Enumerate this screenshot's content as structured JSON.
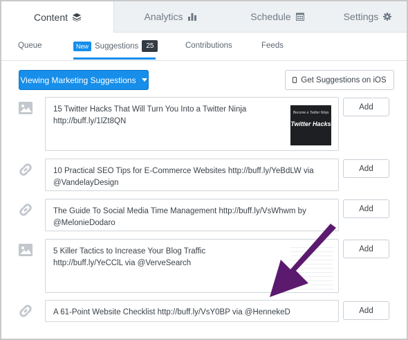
{
  "tabs": [
    {
      "label": "Content",
      "icon": "stack-icon",
      "active": true
    },
    {
      "label": "Analytics",
      "icon": "bar-chart-icon",
      "active": false
    },
    {
      "label": "Schedule",
      "icon": "calendar-icon",
      "active": false
    },
    {
      "label": "Settings",
      "icon": "gear-icon",
      "active": false
    }
  ],
  "subtabs": {
    "queue": "Queue",
    "suggestions": "Suggestions",
    "suggestions_badge_new": "New",
    "suggestions_count": "25",
    "contributions": "Contributions",
    "feeds": "Feeds"
  },
  "actions": {
    "viewing_label": "Viewing Marketing Suggestions",
    "ios_label": "Get Suggestions on iOS"
  },
  "suggestions": [
    {
      "type": "image-icon",
      "line1": "15 Twitter Hacks That Will Turn You Into a Twitter Ninja",
      "line2": "http://buff.ly/1lZt8QN",
      "add": "Add",
      "thumbnail_text": "Twitter Hacks",
      "thumbnail_small": "Become a Twitter Ninja"
    },
    {
      "type": "link-icon",
      "line1": "10 Practical SEO Tips for E-Commerce Websites http://buff.ly/YeBdLW via",
      "line2": "@VandelayDesign",
      "add": "Add"
    },
    {
      "type": "link-icon",
      "line1": "The Guide To Social Media Time Management http://buff.ly/VsWhwm by",
      "line2": "@MelonieDodaro",
      "add": "Add"
    },
    {
      "type": "image-icon",
      "line1": "5 Killer Tactics to Increase Your Blog Traffic",
      "line2": "http://buff.ly/YeCClL via @VerveSearch",
      "add": "Add"
    },
    {
      "type": "link-icon",
      "line1": "A 61-Point Website Checklist http://buff.ly/VsY0BP via @HennekeD",
      "line2": "",
      "add": "Add"
    }
  ],
  "colors": {
    "accent": "#168eea",
    "annotation_arrow": "#5b1a6e"
  }
}
